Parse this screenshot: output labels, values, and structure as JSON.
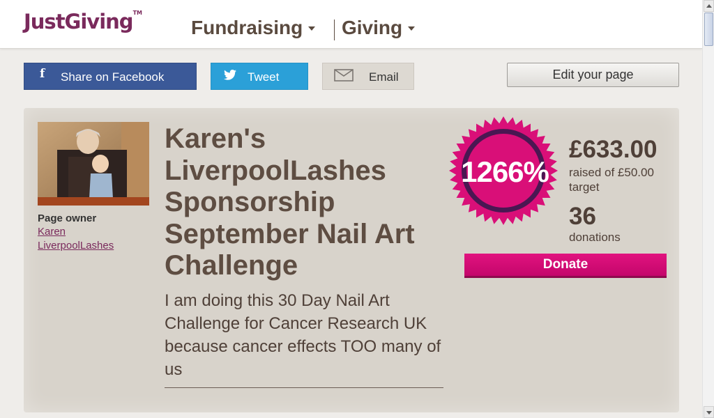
{
  "header": {
    "logo": "JustGiving",
    "logo_tm": "TM",
    "nav": [
      {
        "label": "Fundraising"
      },
      {
        "label": "Giving"
      }
    ]
  },
  "share": {
    "facebook_label": "Share on Facebook",
    "tweet_label": "Tweet",
    "email_label": "Email",
    "edit_label": "Edit your page"
  },
  "page": {
    "owner_label": "Page owner",
    "owner_name": "Karen LiverpoolLashes",
    "title": "Karen's LiverpoolLashes Sponsorship September Nail Art Challenge",
    "summary": "I am doing this 30 Day Nail Art Challenge for Cancer Research UK because cancer effects TOO many of us"
  },
  "stats": {
    "percent": "1266%",
    "raised": "£633.00",
    "raised_sub": "raised of £50.00 target",
    "donations_count": "36",
    "donations_label": "donations",
    "donate_label": "Donate"
  },
  "colors": {
    "brand": "#7a2a5c",
    "donate": "#d90f78",
    "facebook": "#3b5998",
    "twitter": "#2ba0d8",
    "panel": "#d8d3cb"
  },
  "icons": {
    "facebook": "facebook-icon",
    "twitter": "twitter-icon",
    "email": "envelope-icon"
  }
}
